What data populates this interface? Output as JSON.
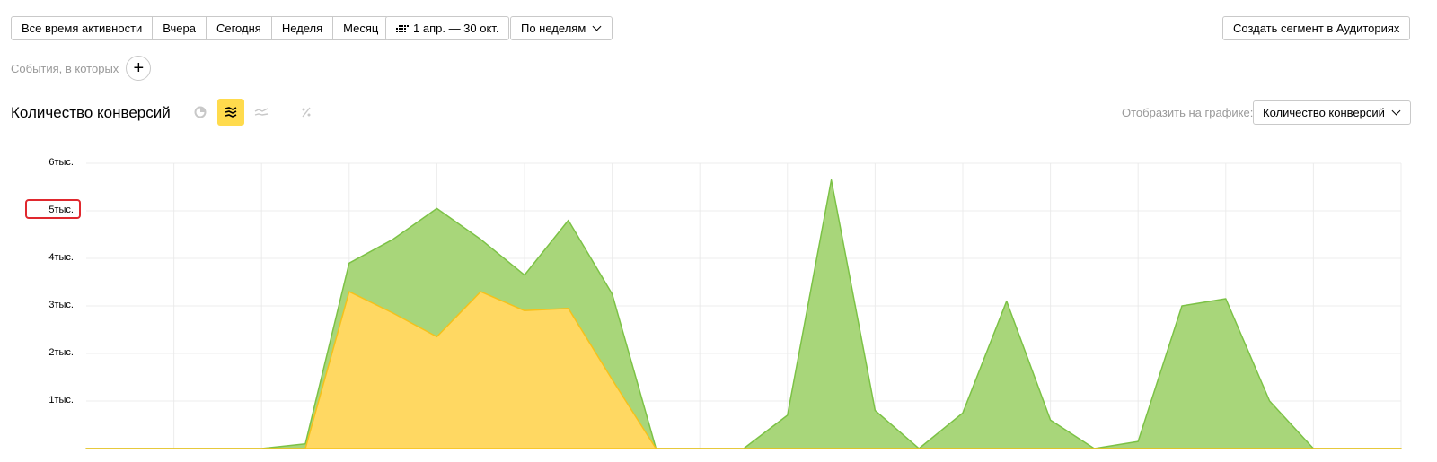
{
  "period_buttons": [
    "Все время активности",
    "Вчера",
    "Сегодня",
    "Неделя",
    "Месяц"
  ],
  "date_range": "1 апр. — 30 окт.",
  "grouping": "По неделям",
  "segment_button": "Создать сегмент в Аудиториях",
  "events_label": "События, в которых",
  "title": "Количество конверсий",
  "display_label": "Отобразить на графике:",
  "display_value": "Количество конверсий",
  "icons": {
    "calendar": "calendar-grid-icon",
    "add": "plus-icon",
    "pie": "pie-chart-icon",
    "stacked": "stacked-area-icon",
    "line": "line-chart-icon",
    "percent": "percent-icon"
  },
  "colors": {
    "green_fill": "#a8d67a",
    "green_stroke": "#7cc246",
    "yellow_fill": "#ffd862",
    "yellow_stroke": "#f5c11a",
    "active_mode": "#ffdb4d",
    "highlight": "#e0282e"
  },
  "chart_data": {
    "type": "area",
    "stacked": false,
    "yticks": [
      "1тыс.",
      "2тыс.",
      "3тыс.",
      "4тыс.",
      "5тыс.",
      "6тыс."
    ],
    "ylim": [
      0,
      6000
    ],
    "grid": true,
    "highlighted_tick": "5тыс.",
    "series": [
      {
        "color": "#a8d67a",
        "values": [
          0,
          0,
          0,
          0,
          0,
          100,
          3900,
          4400,
          5050,
          4400,
          3650,
          4800,
          3250,
          0,
          0,
          0,
          700,
          5650,
          800,
          0,
          750,
          3100,
          600,
          0,
          150,
          3000,
          3150,
          1000,
          0,
          0,
          0
        ]
      },
      {
        "color": "#ffd862",
        "values": [
          0,
          0,
          0,
          0,
          0,
          0,
          3300,
          2850,
          2350,
          3300,
          2900,
          2950,
          1450,
          0,
          0,
          0,
          0,
          0,
          0,
          0,
          0,
          0,
          0,
          0,
          0,
          0,
          0,
          0,
          0,
          0,
          0
        ]
      }
    ]
  }
}
